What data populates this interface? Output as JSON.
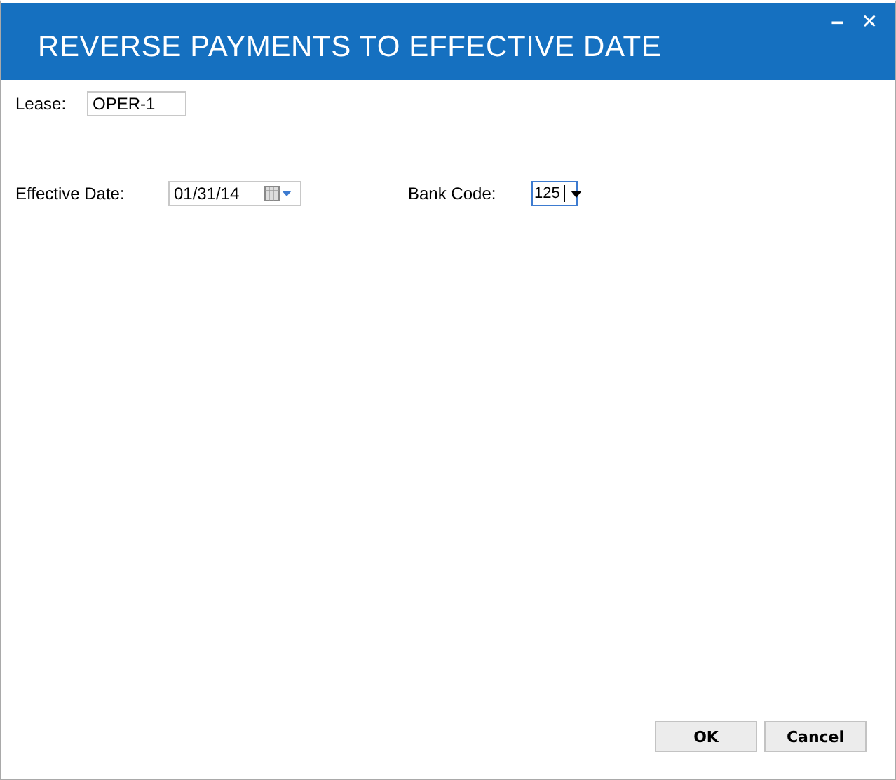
{
  "window": {
    "title": "REVERSE PAYMENTS TO EFFECTIVE DATE",
    "minimize": "‒",
    "close": "✕"
  },
  "lease": {
    "label": "Lease:",
    "value": "OPER-1"
  },
  "effective_date": {
    "label": "Effective Date:",
    "value": "01/31/14"
  },
  "bank_code": {
    "label": "Bank Code:",
    "value": "125",
    "focused": true
  },
  "buttons": [
    "OK",
    "Cancel"
  ]
}
